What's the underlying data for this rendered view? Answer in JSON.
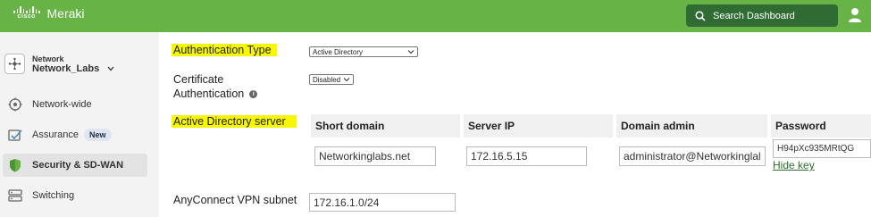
{
  "app": {
    "brand_logo_text": "cisco",
    "brand_name": "Meraki"
  },
  "topbar": {
    "search_placeholder": "Search Dashboard",
    "user_icon": "user-icon"
  },
  "sidebar": {
    "network_label": "Network",
    "network_name": "Network_Labs",
    "items": [
      {
        "label": "Network-wide",
        "icon": "network-wide-icon",
        "active": false
      },
      {
        "label": "Assurance",
        "icon": "assurance-icon",
        "badge": "New",
        "active": false
      },
      {
        "label": "Security & SD-WAN",
        "icon": "shield-icon",
        "active": true
      },
      {
        "label": "Switching",
        "icon": "switch-icon",
        "active": false
      }
    ]
  },
  "form": {
    "auth_type_label": "Authentication Type",
    "auth_type_value": "Active Directory",
    "cert_auth_label_line1": "Certificate",
    "cert_auth_label_line2": "Authentication",
    "cert_auth_value": "Disabled",
    "ad_server_label": "Active Directory server",
    "ad_table": {
      "headers": [
        "Short domain",
        "Server IP",
        "Domain admin",
        "Password"
      ],
      "row": {
        "short_domain": "Networkinglabs.net",
        "server_ip": "172.16.5.15",
        "domain_admin": "administrator@Networkinglal",
        "password": "H94pXc935MRtQG"
      },
      "hide_key_label": "Hide key"
    },
    "vpn_subnet_label": "AnyConnect VPN subnet",
    "vpn_subnet_value": "172.16.1.0/24"
  },
  "colors": {
    "brand_green": "#67b346",
    "search_bg": "#2f6b33",
    "highlight": "#f7f700",
    "link_green": "#2d6e2d"
  }
}
